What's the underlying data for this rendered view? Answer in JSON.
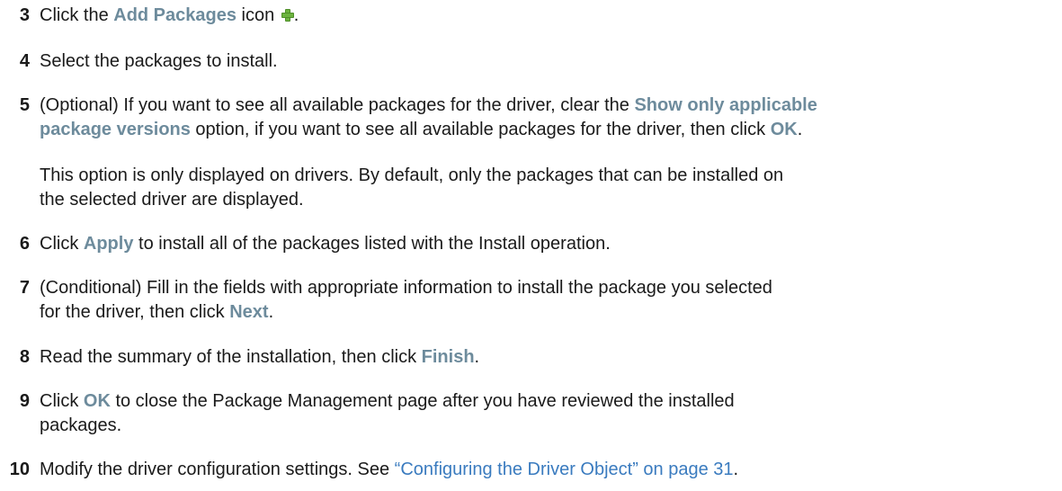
{
  "steps": [
    {
      "num": "3",
      "pre": "Click the ",
      "ui": "Add Packages",
      "post": " icon ",
      "icon": "add-package-icon",
      "end": "."
    },
    {
      "num": "4",
      "text": "Select the packages to install."
    },
    {
      "num": "5",
      "pre": "(Optional) If you want to see all available packages for the driver, clear the ",
      "ui1": "Show only applicable",
      "ui2": "package versions",
      "mid": " option, if you want to see all available packages for the driver, then click ",
      "ui3": "OK",
      "end": "."
    },
    {
      "num": "6",
      "pre": "Click ",
      "ui": "Apply",
      "post": " to install all of the packages listed with the Install operation."
    },
    {
      "num": "7",
      "line1": "(Conditional) Fill in the fields with appropriate information to install the package you selected",
      "pre2": "for the driver, then click ",
      "ui": "Next",
      "end": "."
    },
    {
      "num": "8",
      "pre": "Read the summary of the installation, then click ",
      "ui": "Finish",
      "end": "."
    },
    {
      "num": "9",
      "pre": "Click ",
      "ui": "OK",
      "post": " to close the Package Management page after you have reviewed the installed",
      "line2": "packages."
    },
    {
      "num": "10",
      "pre": "Modify the driver configuration settings. See ",
      "link": "“Configuring the Driver Object” on page 31",
      "end": "."
    }
  ],
  "note": {
    "line1": "This option is only displayed on drivers. By default, only the packages that can be installed on",
    "line2": "the selected driver are displayed."
  },
  "colors": {
    "ui_label": "#6d8b9c",
    "link": "#3a7bbf",
    "icon_green": "#6cb33f"
  }
}
